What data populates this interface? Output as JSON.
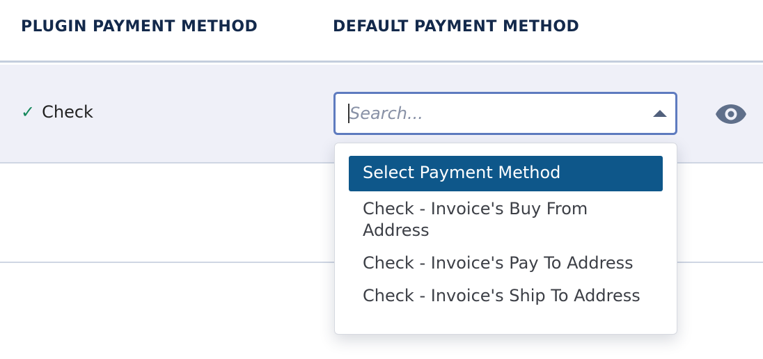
{
  "table": {
    "headers": {
      "plugin": "PLUGIN PAYMENT METHOD",
      "default": "DEFAULT PAYMENT METHOD"
    },
    "rows": [
      {
        "plugin_method": "Check",
        "check_glyph": "✓"
      }
    ]
  },
  "select": {
    "placeholder": "Search...",
    "options": [
      "Select Payment Method",
      "Check - Invoice's Buy From Address",
      "Check - Invoice's Pay To Address",
      "Check - Invoice's Ship To Address"
    ],
    "selected_index": 0
  },
  "icons": {
    "check": "checkmark-icon",
    "caret": "caret-up-icon",
    "view": "eye-icon"
  },
  "colors": {
    "header_text": "#13294b",
    "row_background": "#eff0f8",
    "select_border": "#5e7bbf",
    "selected_option_bg": "#0e578a",
    "check_green": "#14885b",
    "eye_icon": "#5f6f8a"
  }
}
